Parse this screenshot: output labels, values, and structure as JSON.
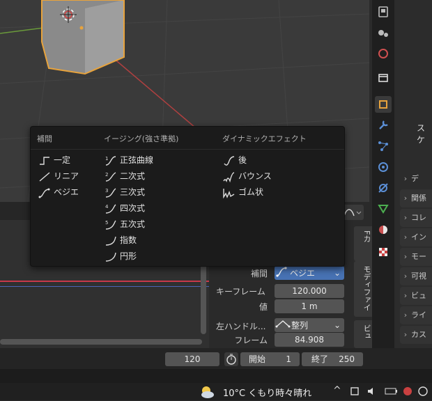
{
  "menu": {
    "columns": [
      {
        "header": "補間",
        "items": [
          {
            "label": "一定",
            "icon": "constant-icon"
          },
          {
            "label": "リニア",
            "icon": "linear-icon"
          },
          {
            "label": "ベジエ",
            "icon": "bezier-icon"
          }
        ]
      },
      {
        "header": "イージング(強さ準拠)",
        "items": [
          {
            "label": "正弦曲線",
            "icon": "sine-icon"
          },
          {
            "label": "二次式",
            "icon": "quad-icon"
          },
          {
            "label": "三次式",
            "icon": "cubic-icon"
          },
          {
            "label": "四次式",
            "icon": "quart-icon"
          },
          {
            "label": "五次式",
            "icon": "quint-icon"
          },
          {
            "label": "指数",
            "icon": "expo-icon"
          },
          {
            "label": "円形",
            "icon": "circ-icon"
          }
        ]
      },
      {
        "header": "ダイナミックエフェクト",
        "items": [
          {
            "label": "後",
            "icon": "back-icon"
          },
          {
            "label": "バウンス",
            "icon": "bounce-icon"
          },
          {
            "label": "ゴム状",
            "icon": "elastic-icon"
          }
        ]
      }
    ]
  },
  "properties": {
    "sections": [
      "スケ",
      "デ",
      "関係",
      "コレ",
      "イン",
      "モー",
      "可視",
      "ビュ",
      "ライ",
      "カス"
    ]
  },
  "sidebar": {
    "tabs": [
      "Fカ",
      "モディファイ",
      "ビュ"
    ],
    "interp_label": "補間",
    "interp_value": "ベジエ",
    "keyframe_label": "キーフレーム",
    "keyframe_value": "120.000",
    "value_label": "値",
    "value_value": "1 m",
    "left_handle_label": "左ハンドル...",
    "left_handle_value": "整列",
    "frame_label": "フレーム",
    "frame_value": "84.908"
  },
  "timeline": {
    "current_frame": "120",
    "start_label": "開始",
    "start_value": "1",
    "end_label": "終了",
    "end_value": "250"
  },
  "taskbar": {
    "weather": "10°C  くもり時々晴れ",
    "chevron": "^"
  },
  "colors": {
    "accent": "#e8a33c",
    "selected_field": "#4772b3",
    "menu_bg": "#1b1b1b"
  }
}
